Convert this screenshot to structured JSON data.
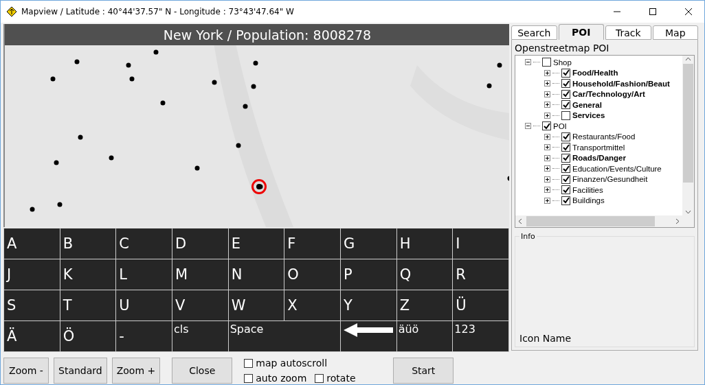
{
  "window": {
    "title": "Mapview / Latitude : 40°44'37.57\" N - Longitude : 73°43'47.64\" W"
  },
  "map": {
    "kind": "picture",
    "banner": "New York / Population: 8008278"
  },
  "keyboard": [
    {
      "kind": "char",
      "label": "A"
    },
    {
      "kind": "char",
      "label": "B"
    },
    {
      "kind": "char",
      "label": "C"
    },
    {
      "kind": "char",
      "label": "D"
    },
    {
      "kind": "char",
      "label": "E"
    },
    {
      "kind": "char",
      "label": "F"
    },
    {
      "kind": "char",
      "label": "G"
    },
    {
      "kind": "char",
      "label": "H"
    },
    {
      "kind": "char",
      "label": "I"
    },
    {
      "kind": "char",
      "label": "J"
    },
    {
      "kind": "char",
      "label": "K"
    },
    {
      "kind": "char",
      "label": "L"
    },
    {
      "kind": "char",
      "label": "M"
    },
    {
      "kind": "char",
      "label": "N"
    },
    {
      "kind": "char",
      "label": "O"
    },
    {
      "kind": "char",
      "label": "P"
    },
    {
      "kind": "char",
      "label": "Q"
    },
    {
      "kind": "char",
      "label": "R"
    },
    {
      "kind": "char",
      "label": "S"
    },
    {
      "kind": "char",
      "label": "T"
    },
    {
      "kind": "char",
      "label": "U"
    },
    {
      "kind": "char",
      "label": "V"
    },
    {
      "kind": "char",
      "label": "W"
    },
    {
      "kind": "char",
      "label": "X"
    },
    {
      "kind": "char",
      "label": "Y"
    },
    {
      "kind": "char",
      "label": "Z"
    },
    {
      "kind": "char",
      "label": "Ü"
    },
    {
      "kind": "char",
      "label": "Ä"
    },
    {
      "kind": "char",
      "label": "Ö"
    },
    {
      "kind": "char",
      "label": "-"
    },
    {
      "kind": "word",
      "label": "cls"
    },
    {
      "kind": "wide",
      "label": "Space"
    },
    {
      "kind": "arrow"
    },
    {
      "kind": "word",
      "label": "äüö"
    },
    {
      "kind": "word",
      "label": "123"
    }
  ],
  "buttons": [
    {
      "label": "Zoom -"
    },
    {
      "label": "Standard"
    },
    {
      "label": "Zoom +"
    },
    {
      "label": "Close"
    }
  ],
  "options": [
    {
      "label": "map autoscroll",
      "checked": false
    },
    {
      "label": "auto zoom",
      "checked": false
    },
    {
      "label": "rotate",
      "checked": false
    }
  ],
  "start_button": "Start",
  "tabs": [
    {
      "label": "Search",
      "selected": false
    },
    {
      "label": "POI",
      "selected": true
    },
    {
      "label": "Track",
      "selected": false
    },
    {
      "label": "Map",
      "selected": false
    }
  ],
  "poi": {
    "title": "Openstreetmap POI",
    "tree": [
      {
        "label": "Shop",
        "checked": false,
        "bold": false,
        "expanded": true,
        "children": [
          {
            "label": "Food/Health",
            "checked": true,
            "bold": true,
            "expanded": false
          },
          {
            "label": "Household/Fashion/Beaut",
            "checked": true,
            "bold": true,
            "expanded": false
          },
          {
            "label": "Car/Technology/Art",
            "checked": true,
            "bold": true,
            "expanded": false
          },
          {
            "label": "General",
            "checked": true,
            "bold": true,
            "expanded": false
          },
          {
            "label": "Services",
            "checked": false,
            "bold": true,
            "expanded": false
          }
        ]
      },
      {
        "label": "POI",
        "checked": true,
        "bold": false,
        "expanded": true,
        "children": [
          {
            "label": "Restaurants/Food",
            "checked": true,
            "bold": false,
            "expanded": false
          },
          {
            "label": "Transportmittel",
            "checked": true,
            "bold": false,
            "expanded": false
          },
          {
            "label": "Roads/Danger",
            "checked": true,
            "bold": true,
            "expanded": false
          },
          {
            "label": "Education/Events/Culture",
            "checked": true,
            "bold": false,
            "expanded": false
          },
          {
            "label": "Finanzen/Gesundheit",
            "checked": true,
            "bold": false,
            "expanded": false
          },
          {
            "label": "Facilities",
            "checked": true,
            "bold": false,
            "expanded": false
          },
          {
            "label": "Buildings",
            "checked": true,
            "bold": false,
            "expanded": false
          }
        ]
      }
    ]
  },
  "info": {
    "legend": "Info",
    "text": "Icon Name"
  }
}
